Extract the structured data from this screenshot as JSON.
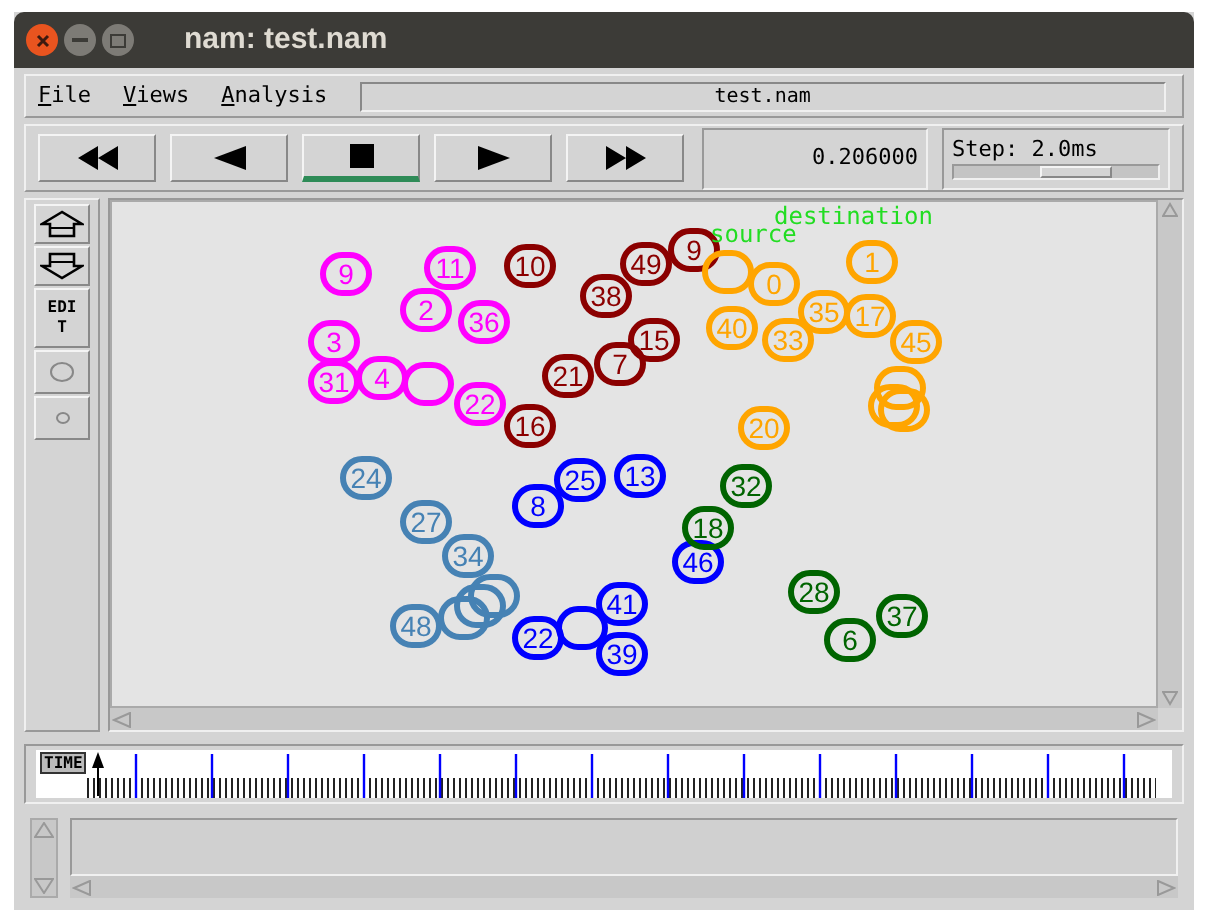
{
  "window": {
    "title": "nam: test.nam"
  },
  "menu": [
    "File",
    "Views",
    "Analysis"
  ],
  "file_field": "test.nam",
  "transport": [
    {
      "kind": "fast-rewind",
      "selected": false
    },
    {
      "kind": "rewind",
      "selected": false
    },
    {
      "kind": "stop",
      "selected": true
    },
    {
      "kind": "play",
      "selected": false
    },
    {
      "kind": "fast-forward",
      "selected": false
    }
  ],
  "time": "0.206000",
  "step": {
    "label": "Step: 2.0ms",
    "level": 0.6
  },
  "tools": [
    {
      "kind": "zoom-in"
    },
    {
      "kind": "zoom-out"
    },
    {
      "kind": "edit",
      "label": "EDIT"
    },
    {
      "kind": "circle-large"
    },
    {
      "kind": "circle-small"
    }
  ],
  "canvas": {
    "nodes": [
      {
        "label": "9",
        "color": "#ff00ff"
      },
      {
        "label": "11",
        "color": "#ff00ff"
      },
      {
        "label": "2",
        "color": "#ff00ff"
      },
      {
        "label": "36",
        "color": "#ff00ff"
      },
      {
        "label": "3",
        "color": "#ff00ff"
      },
      {
        "label": "31",
        "color": "#ff00ff"
      },
      {
        "label": "4",
        "color": "#ff00ff"
      },
      {
        "color": "#ff00ff"
      },
      {
        "label": "22",
        "color": "#ff00ff"
      },
      {
        "label": "10",
        "color": "#8b0000"
      },
      {
        "label": "38",
        "color": "#8b0000"
      },
      {
        "label": "49",
        "color": "#8b0000"
      },
      {
        "label": "9",
        "color": "#8b0000"
      },
      {
        "label": "15",
        "color": "#8b0000"
      },
      {
        "label": "7",
        "color": "#8b0000"
      },
      {
        "label": "21",
        "color": "#8b0000"
      },
      {
        "label": "16",
        "color": "#8b0000"
      },
      {
        "color": "#ffa500"
      },
      {
        "label": "0",
        "color": "#ffa500"
      },
      {
        "label": "1",
        "color": "#ffa500"
      },
      {
        "label": "40",
        "color": "#ffa500"
      },
      {
        "label": "33",
        "color": "#ffa500"
      },
      {
        "label": "35",
        "color": "#ffa500"
      },
      {
        "label": "17",
        "color": "#ffa500"
      },
      {
        "label": "45",
        "color": "#ffa500"
      },
      {
        "color": "#ffa500"
      },
      {
        "color": "#ffa500"
      },
      {
        "color": "#ffa500"
      },
      {
        "label": "20",
        "color": "#ffa500"
      },
      {
        "label": "24",
        "color": "#4682b4"
      },
      {
        "label": "27",
        "color": "#4682b4"
      },
      {
        "label": "34",
        "color": "#4682b4"
      },
      {
        "label": "48",
        "color": "#4682b4"
      },
      {
        "color": "#4682b4"
      },
      {
        "color": "#4682b4"
      },
      {
        "color": "#4682b4"
      },
      {
        "label": "25",
        "color": "#0000ff"
      },
      {
        "label": "13",
        "color": "#0000ff"
      },
      {
        "label": "8",
        "color": "#0000ff"
      },
      {
        "label": "46",
        "color": "#0000ff"
      },
      {
        "label": "41",
        "color": "#0000ff"
      },
      {
        "label": "22",
        "color": "#0000ff"
      },
      {
        "color": "#0000ff"
      },
      {
        "label": "39",
        "color": "#0000ff"
      },
      {
        "label": "32",
        "color": "#006400"
      },
      {
        "label": "18",
        "color": "#006400"
      },
      {
        "label": "28",
        "color": "#006400"
      },
      {
        "label": "37",
        "color": "#006400"
      },
      {
        "label": "6",
        "color": "#006400"
      }
    ],
    "labels": [
      {
        "text": "destination",
        "color": "#22dd22"
      },
      {
        "text": "source",
        "color": "#22dd22"
      }
    ]
  },
  "timeline": {
    "label": "TIME",
    "level": 0.055
  }
}
